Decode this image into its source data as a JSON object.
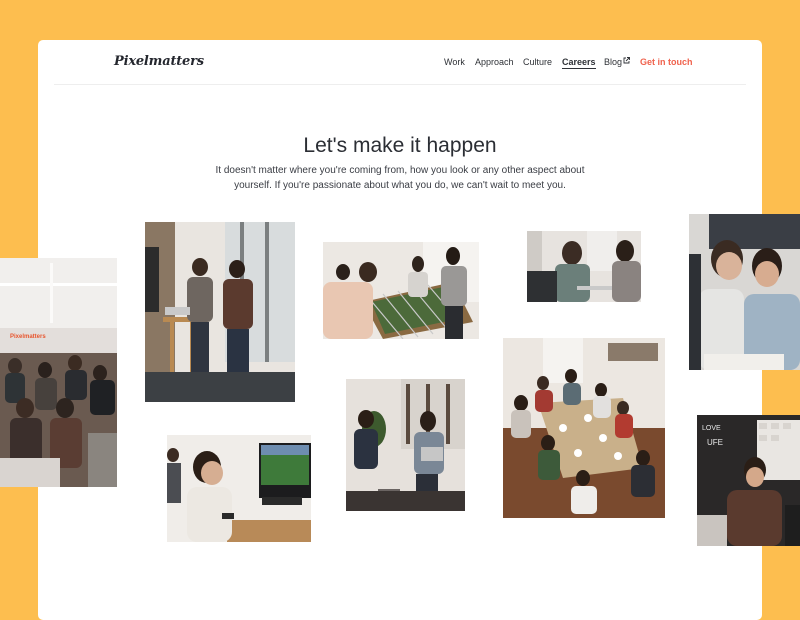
{
  "brand": {
    "logo": "Pixelmatters"
  },
  "nav": {
    "items": [
      "Work",
      "Approach",
      "Culture",
      "Careers",
      "Blog"
    ],
    "active": "Careers",
    "external_icon": "external-link-icon",
    "cta": "Get in touch"
  },
  "hero": {
    "title": "Let's make it happen",
    "description": "It doesn't matter where you're coming from, how you look or any other aspect about yourself. If you're passionate about what you do, we can't wait to meet you."
  },
  "photos": {
    "office_sign": "Pixelmatters"
  },
  "colors": {
    "background": "#FDBE4F",
    "accent": "#f0624d",
    "text": "#2b2e34"
  }
}
